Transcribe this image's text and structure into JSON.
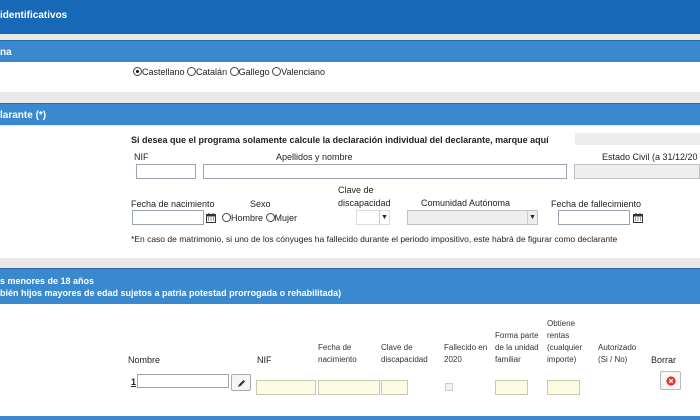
{
  "header": {
    "title": "identificativos"
  },
  "language": {
    "section_title": "na",
    "options": [
      {
        "label": "Castellano",
        "selected": true
      },
      {
        "label": "Catalán",
        "selected": false
      },
      {
        "label": "Gallego",
        "selected": false
      },
      {
        "label": "Valenciano",
        "selected": false
      }
    ]
  },
  "declarant": {
    "section_title": "larante (*)",
    "notice": "Si desea que el programa solamente calcule la declaración individual del declarante, marque aquí",
    "nif_label": "NIF",
    "name_label": "Apellidos y nombre",
    "civil_status_label": "Estado Civil (a 31/12/20",
    "birth_label": "Fecha de nacimiento",
    "sex_label": "Sexo",
    "sex_male": "Hombre",
    "sex_female": "Mujer",
    "disability_label_1": "Clave de",
    "disability_label_2": "discapacidad",
    "community_label": "Comunidad Autónoma",
    "death_label": "Fecha de fallecimiento",
    "footnote": "*En caso de matrimonio, si uno de los cónyuges ha fallecido durante el periodo impositivo, este habrá de figurar como declarante"
  },
  "children": {
    "section_title_1": "s menores de 18 años",
    "section_title_2": "bién hijos mayores de edad sujetos a patria potestad prorrogada o rehabilitada)",
    "columns": {
      "name": "Nombre",
      "nif": "NIF",
      "birth": "Fecha de nacimiento",
      "disability": "Clave de discapacidad",
      "deceased": "Fallecido en 2020",
      "family_unit": "Forma parte de la unidad familiar",
      "income": "Obtiene rentas (cualquier importe)",
      "authorized": "Autorizado (Si / No)",
      "delete": "Borrar"
    },
    "row_number": "1"
  },
  "colors": {
    "title_bar": "#1868b8",
    "section_bar": "#3a89cf"
  }
}
